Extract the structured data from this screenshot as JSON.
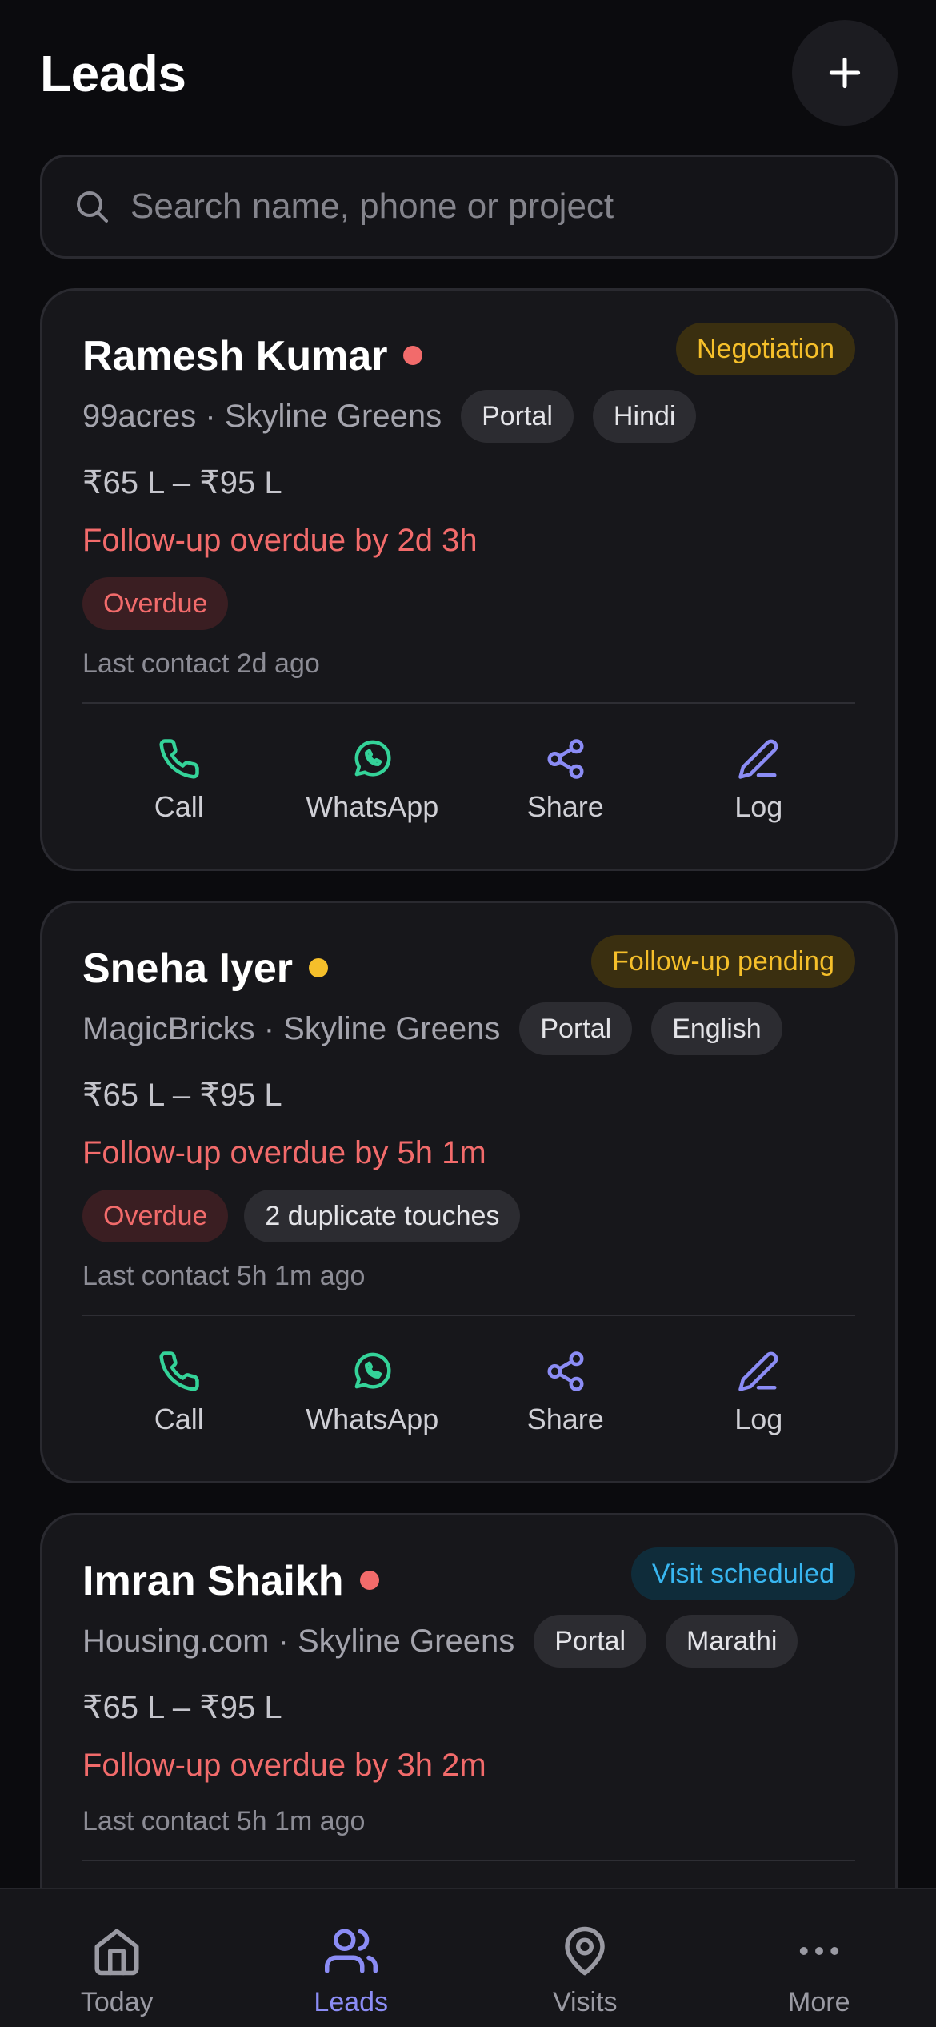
{
  "header": {
    "title": "Leads",
    "add_icon": "plus-icon"
  },
  "search": {
    "placeholder": "Search name, phone or project",
    "icon": "search-icon"
  },
  "colors": {
    "overdue_red": "#f26b6b",
    "pending_yellow": "#f5bf2a",
    "visit_blue": "#38b6f0",
    "call_green": "#34d399",
    "accent_purple": "#8b8cf5"
  },
  "actions": [
    {
      "label": "Call",
      "icon": "phone-icon"
    },
    {
      "label": "WhatsApp",
      "icon": "whatsapp-icon"
    },
    {
      "label": "Share",
      "icon": "share-icon"
    },
    {
      "label": "Log",
      "icon": "pencil-icon"
    }
  ],
  "leads": [
    {
      "name": "Ramesh Kumar",
      "priority_color": "#f26b6b",
      "status": "Negotiation",
      "source": "99acres · Skyline Greens",
      "chips": [
        "Portal",
        "Hindi"
      ],
      "budget": "₹65 L – ₹95 L",
      "followup": "Follow-up overdue by 2d 3h",
      "tags": [
        "Overdue"
      ],
      "last_contact": "Last contact 2d ago"
    },
    {
      "name": "Sneha Iyer",
      "priority_color": "#f5bf2a",
      "status": "Follow-up pending",
      "source": "MagicBricks · Skyline Greens",
      "chips": [
        "Portal",
        "English"
      ],
      "budget": "₹65 L – ₹95 L",
      "followup": "Follow-up overdue by 5h 1m",
      "tags": [
        "Overdue",
        "2 duplicate touches"
      ],
      "last_contact": "Last contact 5h 1m ago"
    },
    {
      "name": "Imran Shaikh",
      "priority_color": "#f26b6b",
      "status": "Visit scheduled",
      "source": "Housing.com · Skyline Greens",
      "chips": [
        "Portal",
        "Marathi"
      ],
      "budget": "₹65 L – ₹95 L",
      "followup": "Follow-up overdue by 3h 2m",
      "tags": [],
      "last_contact": "Last contact 5h 1m ago"
    }
  ],
  "nav": [
    {
      "label": "Today",
      "icon": "home-icon",
      "active": false
    },
    {
      "label": "Leads",
      "icon": "users-icon",
      "active": true
    },
    {
      "label": "Visits",
      "icon": "map-pin-icon",
      "active": false
    },
    {
      "label": "More",
      "icon": "more-dots-icon",
      "active": false
    }
  ]
}
